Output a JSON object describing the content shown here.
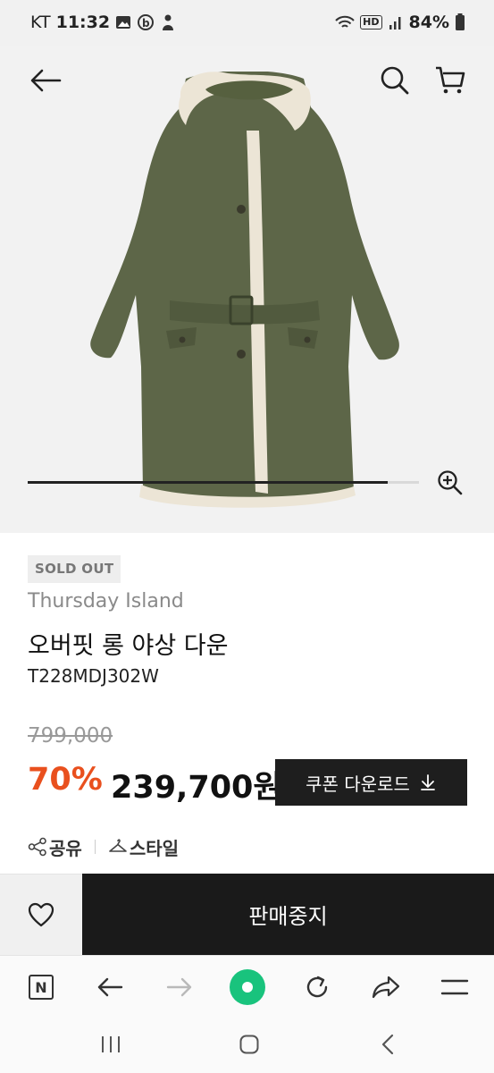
{
  "status_bar": {
    "carrier": "KT",
    "time": "11:32",
    "network_label": "HD",
    "battery": "84%"
  },
  "header": {
    "back_icon": "arrow-left-icon",
    "search_icon": "search-icon",
    "cart_icon": "cart-icon"
  },
  "gallery": {
    "zoom_icon": "zoom-in-icon",
    "progress": 0.92
  },
  "product": {
    "badge": "SOLD OUT",
    "brand": "Thursday Island",
    "name": "오버핏 롱 야상 다운",
    "code": "T228MDJ302W",
    "original_price": "799,000",
    "discount": "70%",
    "sale_price": "239,700원",
    "coupon_label": "쿠폰 다운로드",
    "coupon_icon": "download-icon"
  },
  "actions": {
    "share_label": "공유",
    "style_label": "스타일",
    "wish_icon": "heart-icon",
    "stop_sale_label": "판매중지"
  },
  "browser_toolbar": {
    "home_label": "N",
    "back_icon": "arrow-left-icon",
    "forward_icon": "arrow-right-icon",
    "green_dot_icon": "green-dot-icon",
    "refresh_icon": "refresh-icon",
    "share_icon": "share-arrow-icon",
    "menu_icon": "menu-icon",
    "accent_color": "#19c37d"
  },
  "system_nav": {
    "recents_icon": "recents-icon",
    "home_icon": "home-icon",
    "back_icon": "chevron-left-icon"
  }
}
